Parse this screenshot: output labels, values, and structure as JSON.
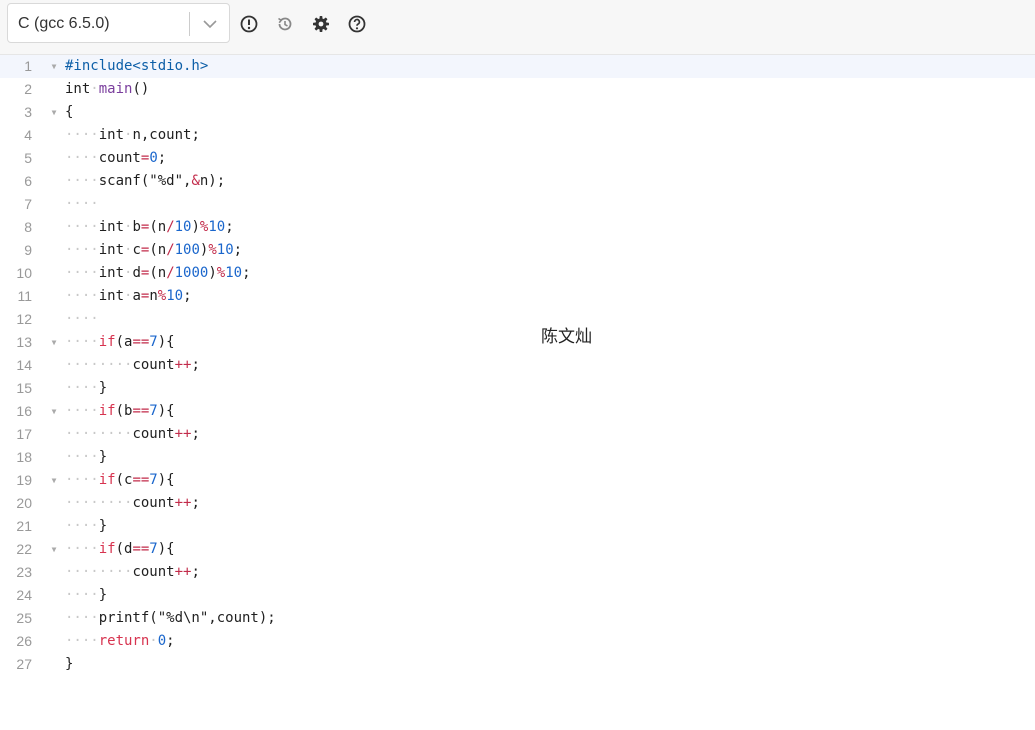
{
  "toolbar": {
    "language": "C (gcc 6.5.0)",
    "icons": [
      "alert-circle-icon",
      "history-icon",
      "gear-icon",
      "help-icon"
    ]
  },
  "colors": {
    "keyword_control": "#d7334f",
    "number": "#1a66cc",
    "preprocessor": "#0d5fa8",
    "function": "#7a3e9d",
    "active_line": "#f3f6fd"
  },
  "code_lines": [
    {
      "n": "1",
      "fold": true,
      "tokens": [
        [
          "pp",
          "#include<stdio.h>"
        ]
      ]
    },
    {
      "n": "2",
      "fold": false,
      "tokens": [
        [
          "kw",
          "int"
        ],
        [
          "sp",
          " "
        ],
        [
          "fn",
          "main"
        ],
        [
          "",
          "()"
        ]
      ]
    },
    {
      "n": "3",
      "fold": true,
      "tokens": [
        [
          "",
          "{"
        ]
      ]
    },
    {
      "n": "4",
      "fold": false,
      "tokens": [
        [
          "ind",
          "····"
        ],
        [
          "kw",
          "int"
        ],
        [
          "sp",
          " "
        ],
        [
          "",
          "n,count;"
        ]
      ]
    },
    {
      "n": "5",
      "fold": false,
      "tokens": [
        [
          "ind",
          "····"
        ],
        [
          "",
          "count"
        ],
        [
          "op",
          "="
        ],
        [
          "num",
          "0"
        ],
        [
          "",
          ";"
        ]
      ]
    },
    {
      "n": "6",
      "fold": false,
      "tokens": [
        [
          "ind",
          "····"
        ],
        [
          "",
          "scanf(\"%d\","
        ],
        [
          "op",
          "&"
        ],
        [
          "",
          "n);"
        ]
      ]
    },
    {
      "n": "7",
      "fold": false,
      "tokens": [
        [
          "ind",
          "····"
        ]
      ]
    },
    {
      "n": "8",
      "fold": false,
      "tokens": [
        [
          "ind",
          "····"
        ],
        [
          "kw",
          "int"
        ],
        [
          "sp",
          " "
        ],
        [
          "",
          "b"
        ],
        [
          "op",
          "="
        ],
        [
          "",
          "(n"
        ],
        [
          "op",
          "/"
        ],
        [
          "num",
          "10"
        ],
        [
          "",
          ")"
        ],
        [
          "op",
          "%"
        ],
        [
          "num",
          "10"
        ],
        [
          "",
          ";"
        ]
      ]
    },
    {
      "n": "9",
      "fold": false,
      "tokens": [
        [
          "ind",
          "····"
        ],
        [
          "kw",
          "int"
        ],
        [
          "sp",
          " "
        ],
        [
          "",
          "c"
        ],
        [
          "op",
          "="
        ],
        [
          "",
          "(n"
        ],
        [
          "op",
          "/"
        ],
        [
          "num",
          "100"
        ],
        [
          "",
          ")"
        ],
        [
          "op",
          "%"
        ],
        [
          "num",
          "10"
        ],
        [
          "",
          ";"
        ]
      ]
    },
    {
      "n": "10",
      "fold": false,
      "tokens": [
        [
          "ind",
          "····"
        ],
        [
          "kw",
          "int"
        ],
        [
          "sp",
          " "
        ],
        [
          "",
          "d"
        ],
        [
          "op",
          "="
        ],
        [
          "",
          "(n"
        ],
        [
          "op",
          "/"
        ],
        [
          "num",
          "1000"
        ],
        [
          "",
          ")"
        ],
        [
          "op",
          "%"
        ],
        [
          "num",
          "10"
        ],
        [
          "",
          ";"
        ]
      ]
    },
    {
      "n": "11",
      "fold": false,
      "tokens": [
        [
          "ind",
          "····"
        ],
        [
          "kw",
          "int"
        ],
        [
          "sp",
          " "
        ],
        [
          "",
          "a"
        ],
        [
          "op",
          "="
        ],
        [
          "",
          "n"
        ],
        [
          "op",
          "%"
        ],
        [
          "num",
          "10"
        ],
        [
          "",
          ";"
        ]
      ]
    },
    {
      "n": "12",
      "fold": false,
      "tokens": [
        [
          "ind",
          "····"
        ]
      ]
    },
    {
      "n": "13",
      "fold": true,
      "tokens": [
        [
          "ind",
          "····"
        ],
        [
          "ctrl",
          "if"
        ],
        [
          "",
          "(a"
        ],
        [
          "op",
          "=="
        ],
        [
          "num",
          "7"
        ],
        [
          "",
          "){"
        ]
      ]
    },
    {
      "n": "14",
      "fold": false,
      "tokens": [
        [
          "ind",
          "········"
        ],
        [
          "",
          "count"
        ],
        [
          "op",
          "++"
        ],
        [
          "",
          ";"
        ]
      ]
    },
    {
      "n": "15",
      "fold": false,
      "tokens": [
        [
          "ind",
          "····"
        ],
        [
          "",
          "}"
        ]
      ]
    },
    {
      "n": "16",
      "fold": true,
      "tokens": [
        [
          "ind",
          "····"
        ],
        [
          "ctrl",
          "if"
        ],
        [
          "",
          "(b"
        ],
        [
          "op",
          "=="
        ],
        [
          "num",
          "7"
        ],
        [
          "",
          "){"
        ]
      ]
    },
    {
      "n": "17",
      "fold": false,
      "tokens": [
        [
          "ind",
          "········"
        ],
        [
          "",
          "count"
        ],
        [
          "op",
          "++"
        ],
        [
          "",
          ";"
        ]
      ]
    },
    {
      "n": "18",
      "fold": false,
      "tokens": [
        [
          "ind",
          "····"
        ],
        [
          "",
          "}"
        ]
      ]
    },
    {
      "n": "19",
      "fold": true,
      "tokens": [
        [
          "ind",
          "····"
        ],
        [
          "ctrl",
          "if"
        ],
        [
          "",
          "(c"
        ],
        [
          "op",
          "=="
        ],
        [
          "num",
          "7"
        ],
        [
          "",
          "){"
        ]
      ]
    },
    {
      "n": "20",
      "fold": false,
      "tokens": [
        [
          "ind",
          "········"
        ],
        [
          "",
          "count"
        ],
        [
          "op",
          "++"
        ],
        [
          "",
          ";"
        ]
      ]
    },
    {
      "n": "21",
      "fold": false,
      "tokens": [
        [
          "ind",
          "····"
        ],
        [
          "",
          "}"
        ]
      ]
    },
    {
      "n": "22",
      "fold": true,
      "tokens": [
        [
          "ind",
          "····"
        ],
        [
          "ctrl",
          "if"
        ],
        [
          "",
          "(d"
        ],
        [
          "op",
          "=="
        ],
        [
          "num",
          "7"
        ],
        [
          "",
          "){"
        ]
      ]
    },
    {
      "n": "23",
      "fold": false,
      "tokens": [
        [
          "ind",
          "········"
        ],
        [
          "",
          "count"
        ],
        [
          "op",
          "++"
        ],
        [
          "",
          ";"
        ]
      ]
    },
    {
      "n": "24",
      "fold": false,
      "tokens": [
        [
          "ind",
          "····"
        ],
        [
          "",
          "}"
        ]
      ]
    },
    {
      "n": "25",
      "fold": false,
      "tokens": [
        [
          "ind",
          "····"
        ],
        [
          "",
          "printf(\"%d\\n\",count);"
        ]
      ]
    },
    {
      "n": "26",
      "fold": false,
      "tokens": [
        [
          "ind",
          "····"
        ],
        [
          "ctrl",
          "return"
        ],
        [
          "sp",
          " "
        ],
        [
          "num",
          "0"
        ],
        [
          "",
          ";"
        ]
      ]
    },
    {
      "n": "27",
      "fold": false,
      "tokens": [
        [
          "",
          "}"
        ]
      ]
    }
  ],
  "overlay_text": "陈文灿"
}
